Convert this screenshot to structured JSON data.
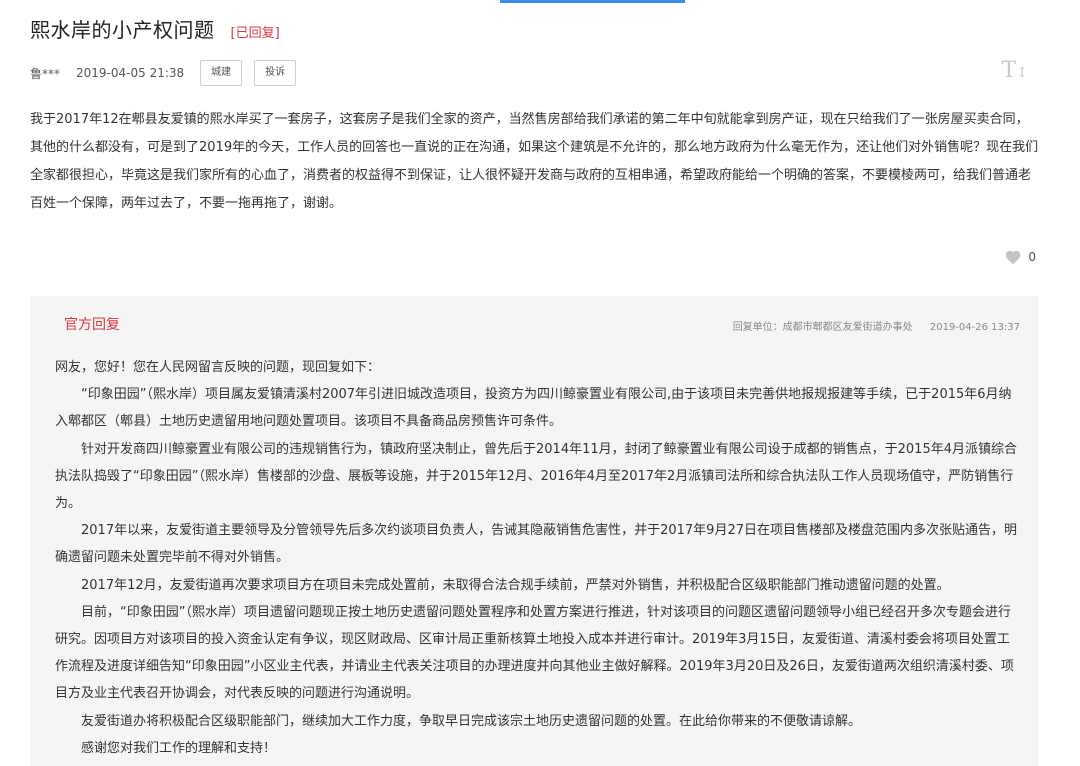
{
  "post": {
    "title": "熙水岸的小产权问题",
    "status": "[已回复]",
    "author": "鲁***",
    "date": "2019-04-05 21:38",
    "tags": [
      "城建",
      "投诉"
    ],
    "font_toggle": "T",
    "content": "我于2017年12在郫县友爱镇的熙水岸买了一套房子，这套房子是我们全家的资产，当然售房部给我们承诺的第二年中旬就能拿到房产证，现在只给我们了一张房屋买卖合同，其他的什么都没有，可是到了2019年的今天，工作人员的回答也一直说的正在沟通，如果这个建筑是不允许的，那么地方政府为什么毫无作为，还让他们对外销售呢？现在我们全家都很担心，毕竟这是我们家所有的心血了，消费者的权益得不到保证，让人很怀疑开发商与政府的互相串通，希望政府能给一个明确的答案，不要模棱两可，给我们普通老百姓一个保障，两年过去了，不要一拖再拖了，谢谢。",
    "likes": "0"
  },
  "reply": {
    "label": "官方回复",
    "unit": "回复单位：成都市郫都区友爱街道办事处",
    "date": "2019-04-26 13:37",
    "paragraphs": [
      "网友，您好！您在人民网留言反映的问题，现回复如下：",
      "“印象田园”（熙水岸）项目属友爱镇清溪村2007年引进旧城改造项目，投资方为四川鲸豪置业有限公司,由于该项目未完善供地报规报建等手续，已于2015年6月纳入郫都区（郫县）土地历史遗留用地问题处置项目。该项目不具备商品房预售许可条件。",
      "针对开发商四川鲸豪置业有限公司的违规销售行为，镇政府坚决制止，曾先后于2014年11月，封闭了鲸豪置业有限公司设于成都的销售点，于2015年4月派镇综合执法队捣毁了“印象田园”（熙水岸）售楼部的沙盘、展板等设施，并于2015年12月、2016年4月至2017年2月派镇司法所和综合执法队工作人员现场值守，严防销售行为。",
      "2017年以来，友爱街道主要领导及分管领导先后多次约谈项目负责人，告诫其隐蔽销售危害性，并于2017年9月27日在项目售楼部及楼盘范围内多次张贴通告，明确遗留问题未处置完毕前不得对外销售。",
      "2017年12月，友爱街道再次要求项目方在项目未完成处置前，未取得合法合规手续前，严禁对外销售，并积极配合区级职能部门推动遗留问题的处置。",
      "目前，“印象田园”（熙水岸）项目遗留问题现正按土地历史遗留问题处置程序和处置方案进行推进，针对该项目的问题区遗留问题领导小组已经召开多次专题会进行研究。因项目方对该项目的投入资金认定有争议，现区财政局、区审计局正重新核算土地投入成本并进行审计。2019年3月15日，友爱街道、清溪村委会将项目处置工作流程及进度详细告知“印象田园”小区业主代表，并请业主代表关注项目的办理进度并向其他业主做好解释。2019年3月20日及26日，友爱街道两次组织清溪村委、项目方及业主代表召开协调会，对代表反映的问题进行沟通说明。",
      "友爱街道办将积极配合区级职能部门，继续加大工作力度，争取早日完成该宗土地历史遗留问题的处置。在此给你带来的不便敬请谅解。",
      "感谢您对我们工作的理解和支持！"
    ]
  },
  "colors": {
    "accent_red": "#d9363e",
    "reply_bg": "#f5f5f5",
    "top_accent": "#3a8ee6"
  },
  "icons": {
    "like": "heart-icon",
    "font_size": "font-size-icon"
  }
}
